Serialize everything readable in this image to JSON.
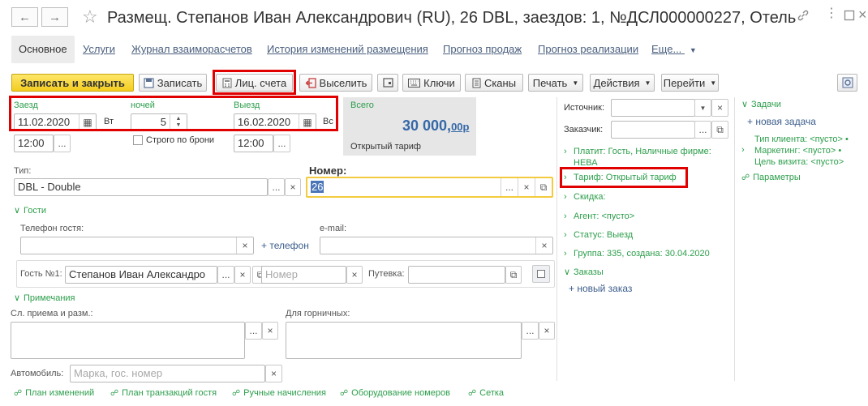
{
  "window": {
    "title": "Размещ. Степанов Иван Александрович (RU), 26 DBL, заездов: 1, №ДСЛ000000227, Отель ...",
    "back_icon": "arrow-left-icon",
    "forward_icon": "arrow-right-icon",
    "favorite_icon": "star-icon",
    "link_icon": "link-icon",
    "menu_icon": "more-vertical-icon",
    "maximize_icon": "maximize-icon",
    "close_icon": "close-icon"
  },
  "tabs": [
    {
      "label": "Основное",
      "active": true
    },
    {
      "label": "Услуги"
    },
    {
      "label": "Журнал взаиморасчетов"
    },
    {
      "label": "История изменений размещения"
    },
    {
      "label": "Прогноз продаж"
    },
    {
      "label": "Прогноз реализации"
    },
    {
      "label": "Еще..."
    }
  ],
  "toolbar": {
    "save_close": "Записать и закрыть",
    "save": "Записать",
    "accounts": "Лиц. счета",
    "checkout": "Выселить",
    "keys": "Ключи",
    "scans": "Сканы",
    "print": "Печать",
    "actions": "Действия",
    "goto": "Перейти"
  },
  "stay": {
    "checkin_label": "Заезд",
    "checkin_date": "11.02.2020",
    "checkin_dow": "Вт",
    "checkin_time": "12:00",
    "nights_label": "ночей",
    "nights": "5",
    "strict_label": "Строго по брони",
    "checkout_label": "Выезд",
    "checkout_date": "16.02.2020",
    "checkout_dow": "Вс",
    "checkout_time": "12:00"
  },
  "total": {
    "label": "Всего",
    "amount_main": "30 000,",
    "amount_cents": "00р",
    "tariff": "Открытый тариф"
  },
  "room": {
    "type_label": "Тип:",
    "type_value": "DBL - Double",
    "number_label": "Номер:",
    "number_value": "26"
  },
  "guests": {
    "section": "Гости",
    "phone_label": "Телефон гостя:",
    "add_phone": "+ телефон",
    "email_label": "e-mail:",
    "guest1_label": "Гость №1:",
    "guest1_value": "Степанов Иван Александро",
    "number_placeholder": "Номер",
    "voucher_label": "Путевка:"
  },
  "notes": {
    "section": "Примечания",
    "reception_label": "Сл. приема и разм.:",
    "maid_label": "Для горничных:",
    "car_label": "Автомобиль:",
    "car_placeholder": "Марка, гос. номер"
  },
  "middle": {
    "source_label": "Источник:",
    "customer_label": "Заказчик:",
    "payer": "Платит: Гость, Наличные фирме:",
    "payer_line2": "НЕВА",
    "tariff": "Тариф: Открытый тариф",
    "discount": "Скидка:",
    "agent": "Агент: <пусто>",
    "status": "Статус: Выезд",
    "group": "Группа: 335, создана: 30.04.2020",
    "orders": "Заказы",
    "new_order": "+ новый заказ"
  },
  "right": {
    "tasks": "Задачи",
    "new_task": "+ новая задача",
    "client_type": "Тип клиента: <пусто> •",
    "marketing": "Маркетинг: <пусто> •",
    "visit_goal": "Цель визита: <пусто>",
    "params": "Параметры"
  },
  "bottom_links": [
    "План изменений",
    "План транзакций гостя",
    "Ручные начисления",
    "Оборудование номеров",
    "Сетка"
  ],
  "colors": {
    "accent_green": "#2c9e4b",
    "primary_yellow": "#f4cd1f",
    "highlight_red": "#e00000",
    "link_blue": "#3b5d8c"
  }
}
